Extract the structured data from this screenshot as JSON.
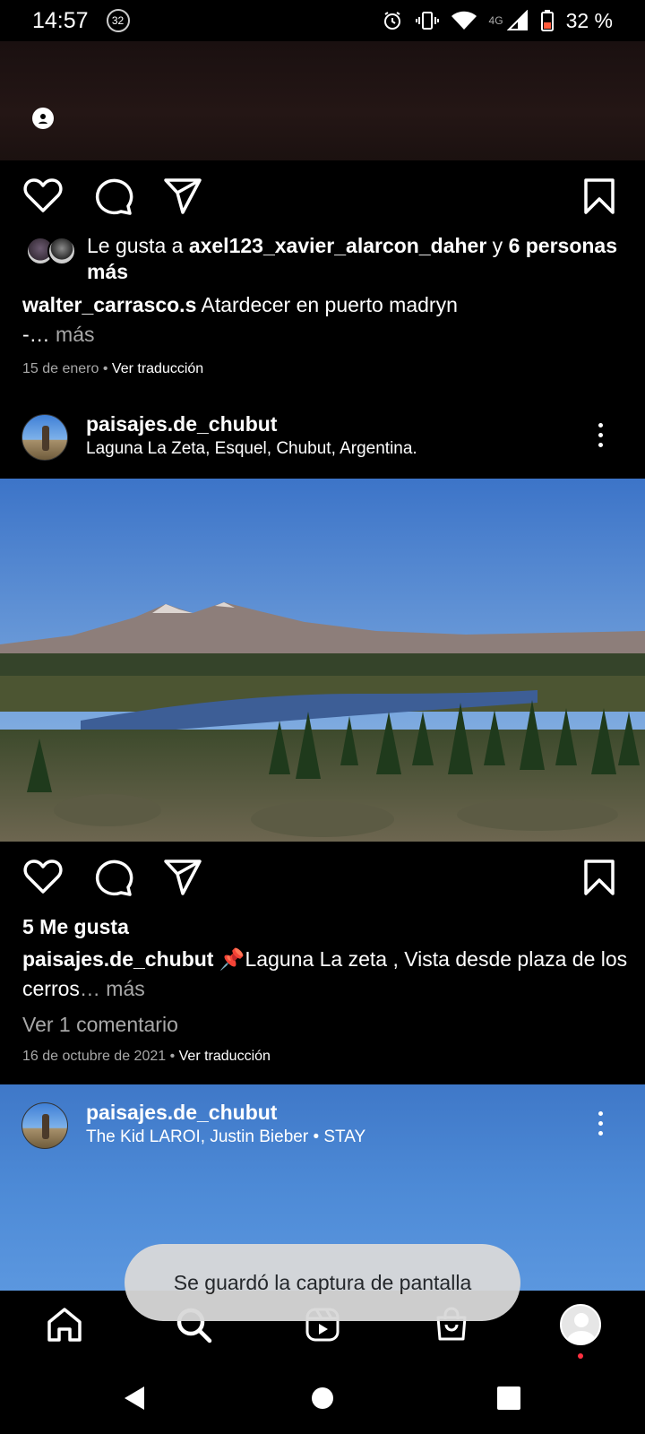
{
  "status_bar": {
    "time": "14:57",
    "notification_count": "32",
    "network": "4G",
    "battery": "32 %"
  },
  "post1": {
    "liked_prefix": "Le gusta a ",
    "liked_user": "axel123_xavier_alarcon_daher",
    "liked_mid": " y ",
    "liked_others": "6 personas más",
    "caption_user": "walter_carrasco.s",
    "caption_text": " Atardecer en puerto madryn",
    "caption_cont": "-…",
    "more": " más",
    "date": "15 de enero",
    "separator": " • ",
    "translate": "Ver traducción"
  },
  "post2": {
    "username": "paisajes.de_chubut",
    "location": "Laguna La Zeta, Esquel, Chubut, Argentina.",
    "likes": "5 Me gusta",
    "caption_user": "paisajes.de_chubut",
    "caption_text": " 📌Laguna La zeta , Vista desde plaza de los cerros",
    "more": "… más",
    "comments": "Ver 1 comentario",
    "date": "16 de octubre de 2021",
    "separator": " • ",
    "translate": "Ver traducción"
  },
  "post3": {
    "username": "paisajes.de_chubut",
    "audio": "The Kid LAROI, Justin Bieber • STAY"
  },
  "toast": {
    "message": "Se guardó la captura de pantalla"
  },
  "icons": {
    "like": "heart-icon",
    "comment": "comment-icon",
    "share": "paper-plane-icon",
    "save": "bookmark-icon",
    "home": "home-icon",
    "search": "search-icon",
    "reels": "reels-icon",
    "shop": "shop-icon",
    "profile": "avatar",
    "back": "back-triangle-icon",
    "home_sys": "home-circle-icon",
    "recents": "recents-square-icon"
  },
  "colors": {
    "background": "#000000",
    "muted_text": "#a8a8a8",
    "notification_dot": "#ff3040",
    "toast_bg": "#d9d9d9"
  }
}
